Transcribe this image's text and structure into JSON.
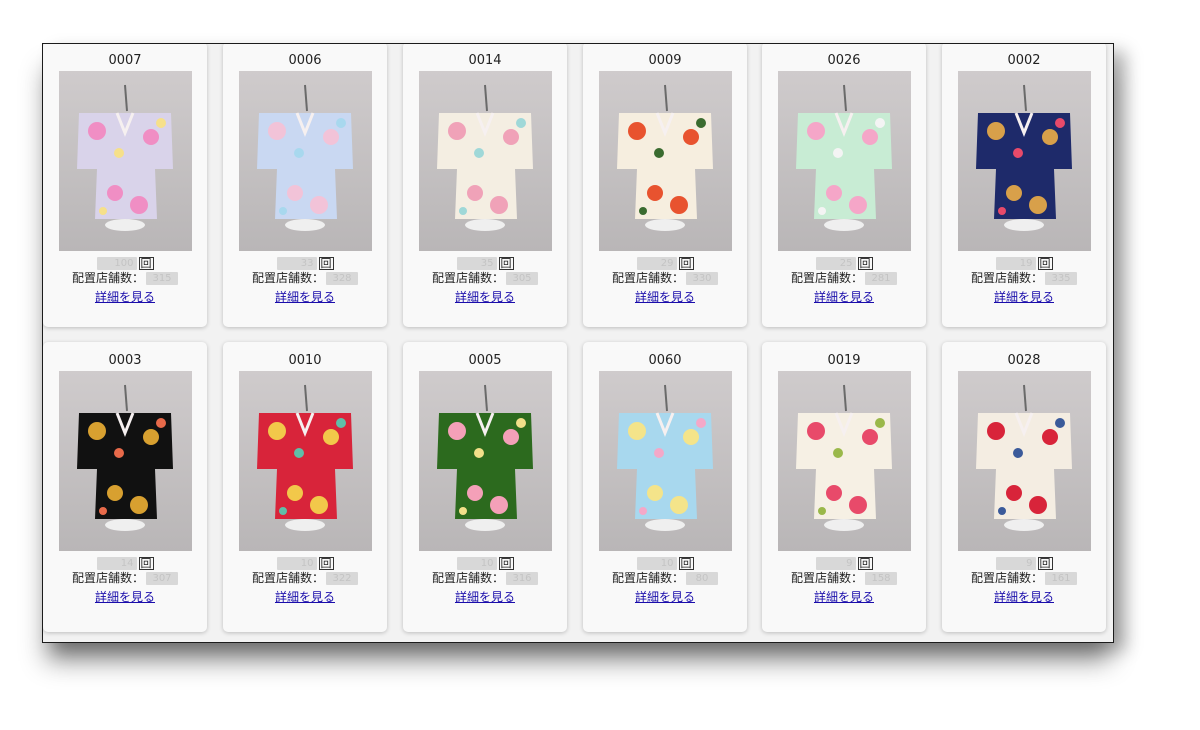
{
  "colors": {
    "link": "#1a0dab",
    "card_bg": "#f9f9f9",
    "panel_bg": "#f2f2f2"
  },
  "labels": {
    "rent_unit": "回",
    "stores_label": "配置店舗数：",
    "detail_link": "詳細を見る"
  },
  "items": [
    {
      "code": "0007",
      "rent": "100",
      "stores": "315",
      "kimono": {
        "base": "#d9d3ea",
        "pattern": "#f08ec4",
        "accent": "#f6e08a"
      }
    },
    {
      "code": "0006",
      "rent": "33",
      "stores": "328",
      "kimono": {
        "base": "#c9d8f2",
        "pattern": "#f2c3d8",
        "accent": "#a8d8ee"
      }
    },
    {
      "code": "0014",
      "rent": "35",
      "stores": "305",
      "kimono": {
        "base": "#f4eee2",
        "pattern": "#f0a2b8",
        "accent": "#9fd8d8"
      }
    },
    {
      "code": "0009",
      "rent": "29",
      "stores": "330",
      "kimono": {
        "base": "#f6eedf",
        "pattern": "#e8532f",
        "accent": "#3a6b2f"
      }
    },
    {
      "code": "0026",
      "rent": "25",
      "stores": "281",
      "kimono": {
        "base": "#c8ecd4",
        "pattern": "#f5a6c8",
        "accent": "#f4f4f4"
      }
    },
    {
      "code": "0002",
      "rent": "19",
      "stores": "335",
      "kimono": {
        "base": "#1e2a6a",
        "pattern": "#d8a04a",
        "accent": "#e84a6a"
      }
    },
    {
      "code": "0003",
      "rent": "14",
      "stores": "307",
      "kimono": {
        "base": "#111111",
        "pattern": "#d8a030",
        "accent": "#e86a4a"
      }
    },
    {
      "code": "0010",
      "rent": "10",
      "stores": "322",
      "kimono": {
        "base": "#d8243a",
        "pattern": "#f2c84a",
        "accent": "#5fbfa8"
      }
    },
    {
      "code": "0005",
      "rent": "10",
      "stores": "316",
      "kimono": {
        "base": "#2c6a1e",
        "pattern": "#f4a0b8",
        "accent": "#f2e08a"
      }
    },
    {
      "code": "0060",
      "rent": "10",
      "stores": "80",
      "kimono": {
        "base": "#a8d8ee",
        "pattern": "#f4e48a",
        "accent": "#f4a8c8"
      }
    },
    {
      "code": "0019",
      "rent": "9",
      "stores": "158",
      "kimono": {
        "base": "#f6f0e4",
        "pattern": "#e84a6a",
        "accent": "#9ab84a"
      }
    },
    {
      "code": "0028",
      "rent": "9",
      "stores": "161",
      "kimono": {
        "base": "#f4ede2",
        "pattern": "#d8243a",
        "accent": "#3a5a9a"
      }
    }
  ]
}
